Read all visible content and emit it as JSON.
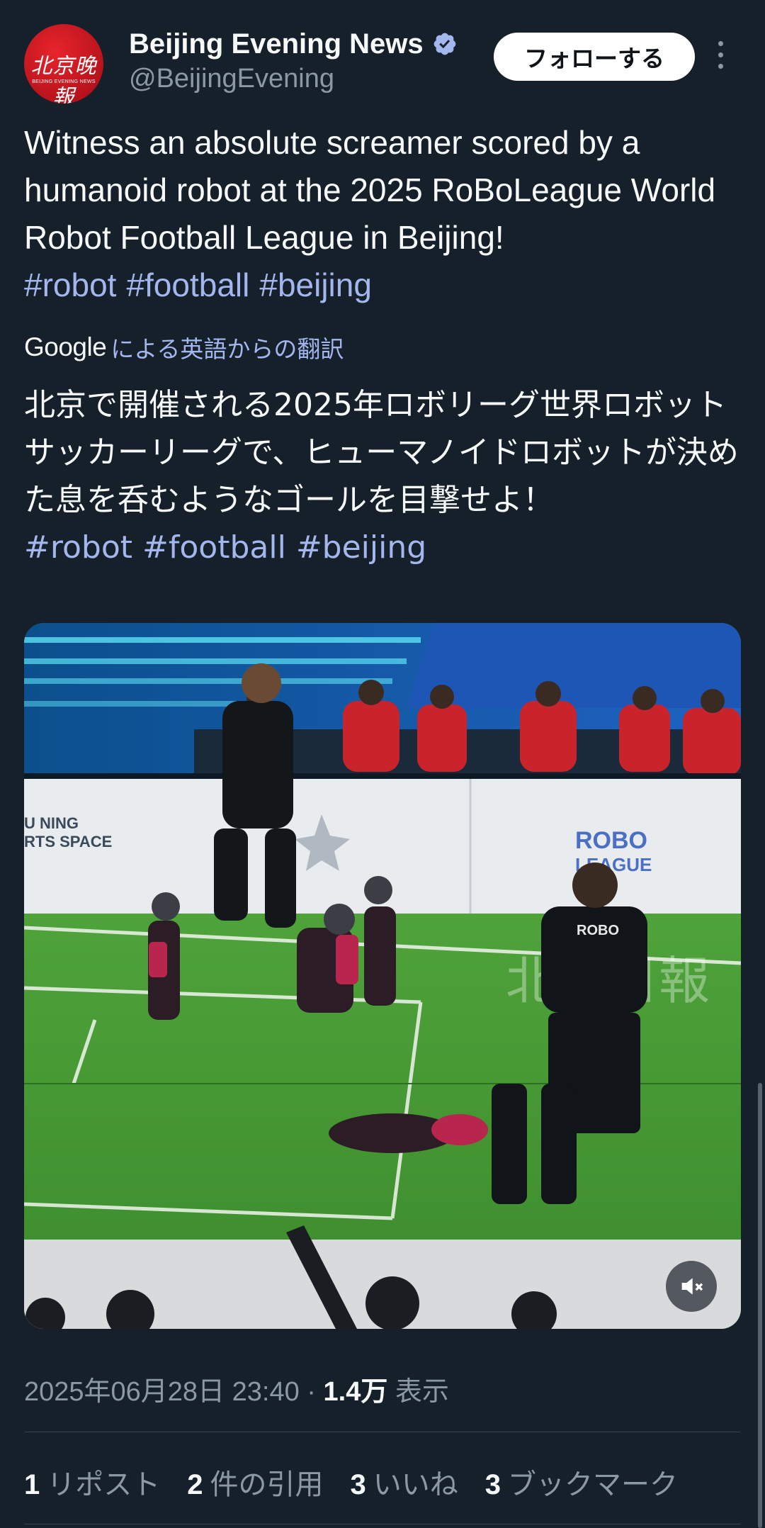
{
  "header": {
    "avatar_text_cn": "北京晚報",
    "avatar_text_en": "BEIJING EVENING NEWS",
    "display_name": "Beijing Evening News",
    "handle": "@BeijingEvening",
    "follow_label": "フォローする"
  },
  "tweet": {
    "text": "Witness an absolute screamer scored by a humanoid robot at the 2025 RoBoLeague World Robot Football League in Beijing!",
    "hashtags": [
      "#robot",
      "#football",
      "#beijing"
    ]
  },
  "translation": {
    "google_label": "Google",
    "label": "による英語からの翻訳",
    "text": "北京で開催される2025年ロボリーグ世界ロボットサッカーリーグで、ヒューマノイドロボットが決めた息を呑むようなゴールを目撃せよ！",
    "hashtags": [
      "#robot",
      "#football",
      "#beijing"
    ]
  },
  "media": {
    "board_text_left": "U NING\nRTS SPACE",
    "board_text_right": "ROBO\nLEAGUE",
    "watermark": "北京日報",
    "shirt_text": "ROBO"
  },
  "meta": {
    "timestamp": "2025年06月28日 23:40",
    "separator": "·",
    "views_count": "1.4万",
    "views_label": "表示"
  },
  "stats": {
    "reposts_count": "1",
    "reposts_label": "リポスト",
    "quotes_count": "2",
    "quotes_label": "件の引用",
    "likes_count": "3",
    "likes_label": "いいね",
    "bookmarks_count": "3",
    "bookmarks_label": "ブックマーク"
  },
  "colors": {
    "background": "#15202b",
    "link": "#a3b7ee",
    "verified": "#a3b7ee",
    "secondary_text": "#8b98a5"
  }
}
